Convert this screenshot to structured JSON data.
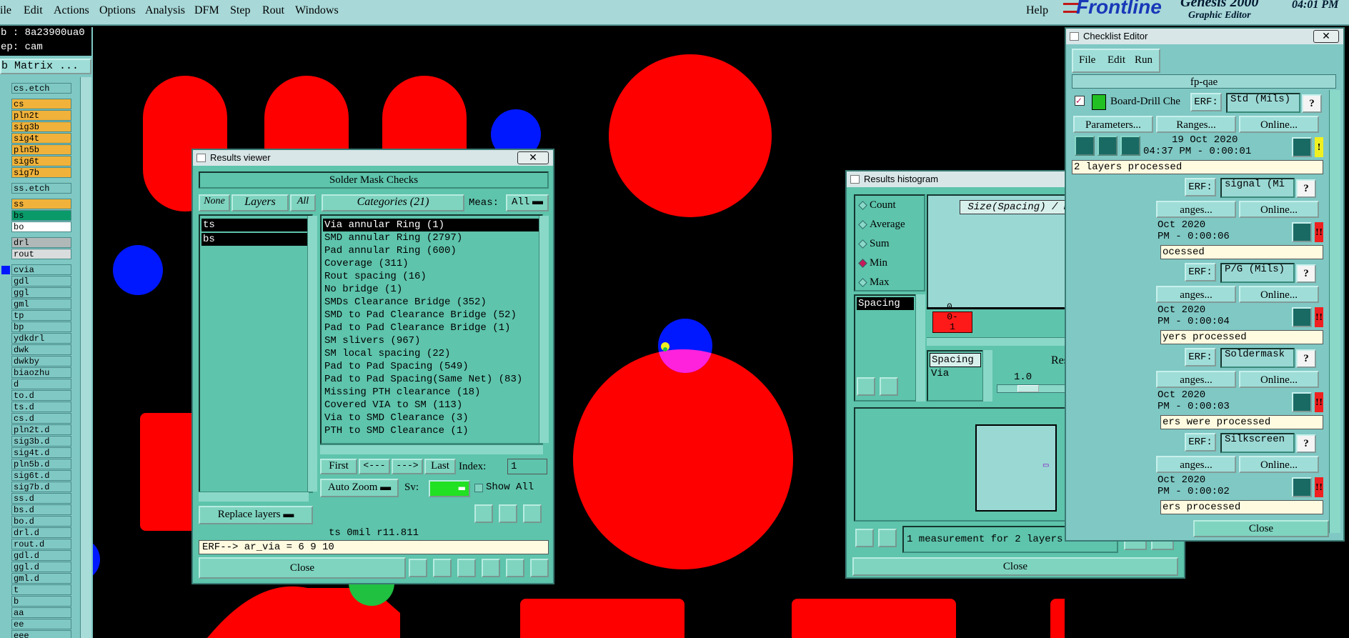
{
  "menubar": {
    "items": [
      "ile",
      "Edit",
      "Actions",
      "Options",
      "Analysis",
      "DFM",
      "Step",
      "Rout",
      "Windows"
    ],
    "help": "Help",
    "brand": "Frontline",
    "product": "Genesis 2000",
    "subtitle": "Graphic Editor",
    "time": "04:01 PM"
  },
  "leftpanel": {
    "job": "b : 8a23900ua0",
    "step": "ep: cam",
    "matrix_button": "b Matrix ...",
    "layers": [
      {
        "name": "cs.etch",
        "color": "#7fc8c4"
      },
      {
        "name": "cs",
        "color": "#f0b23a"
      },
      {
        "name": "pln2t",
        "color": "#f0b23a"
      },
      {
        "name": "sig3b",
        "color": "#f0b23a"
      },
      {
        "name": "sig4t",
        "color": "#f0b23a"
      },
      {
        "name": "pln5b",
        "color": "#f0b23a"
      },
      {
        "name": "sig6t",
        "color": "#f0b23a"
      },
      {
        "name": "sig7b",
        "color": "#f0b23a"
      },
      {
        "name": "ss.etch",
        "color": "#7fc8c4"
      },
      {
        "name": "ss",
        "color": "#f0b23a"
      },
      {
        "name": "bs",
        "color": "#0a9a6a"
      },
      {
        "name": "bo",
        "color": "#ffffff"
      },
      {
        "name": "drl",
        "color": "#b0b8b8"
      },
      {
        "name": "rout",
        "color": "#d8dcdc"
      },
      {
        "name": "cvia",
        "color": "#7fc8c4"
      },
      {
        "name": "gdl",
        "color": "#7fc8c4"
      },
      {
        "name": "ggl",
        "color": "#7fc8c4"
      },
      {
        "name": "gml",
        "color": "#7fc8c4"
      },
      {
        "name": "tp",
        "color": "#7fc8c4"
      },
      {
        "name": "bp",
        "color": "#7fc8c4"
      },
      {
        "name": "ydkdrl",
        "color": "#7fc8c4"
      },
      {
        "name": "dwk",
        "color": "#7fc8c4"
      },
      {
        "name": "dwkby",
        "color": "#7fc8c4"
      },
      {
        "name": "biaozhu",
        "color": "#7fc8c4"
      },
      {
        "name": "d",
        "color": "#7fc8c4"
      },
      {
        "name": "to.d",
        "color": "#7fc8c4"
      },
      {
        "name": "ts.d",
        "color": "#7fc8c4"
      },
      {
        "name": "cs.d",
        "color": "#7fc8c4"
      },
      {
        "name": "pln2t.d",
        "color": "#7fc8c4"
      },
      {
        "name": "sig3b.d",
        "color": "#7fc8c4"
      },
      {
        "name": "sig4t.d",
        "color": "#7fc8c4"
      },
      {
        "name": "pln5b.d",
        "color": "#7fc8c4"
      },
      {
        "name": "sig6t.d",
        "color": "#7fc8c4"
      },
      {
        "name": "sig7b.d",
        "color": "#7fc8c4"
      },
      {
        "name": "ss.d",
        "color": "#7fc8c4"
      },
      {
        "name": "bs.d",
        "color": "#7fc8c4"
      },
      {
        "name": "bo.d",
        "color": "#7fc8c4"
      },
      {
        "name": "drl.d",
        "color": "#7fc8c4"
      },
      {
        "name": "rout.d",
        "color": "#7fc8c4"
      },
      {
        "name": "gdl.d",
        "color": "#7fc8c4"
      },
      {
        "name": "ggl.d",
        "color": "#7fc8c4"
      },
      {
        "name": "gml.d",
        "color": "#7fc8c4"
      },
      {
        "name": "t",
        "color": "#7fc8c4"
      },
      {
        "name": "b",
        "color": "#7fc8c4"
      },
      {
        "name": "aa",
        "color": "#7fc8c4"
      },
      {
        "name": "ee",
        "color": "#7fc8c4"
      },
      {
        "name": "eee",
        "color": "#7fc8c4"
      }
    ]
  },
  "results_viewer": {
    "title": "Results viewer",
    "header": "Solder Mask Checks",
    "none_label": "None",
    "layers_label": "Layers",
    "all_label": "All",
    "categories_label": "Categories (21)",
    "meas_label": "Meas:",
    "meas_value": "All",
    "layers": [
      "ts",
      "bs"
    ],
    "categories": [
      "Via annular Ring (1)",
      "SMD annular Ring (2797)",
      "Pad annular Ring (600)",
      "Coverage (311)",
      "Rout spacing (16)",
      "No bridge (1)",
      "SMDs Clearance Bridge (352)",
      "SMD to Pad Clearance Bridge (52)",
      "Pad to Pad Clearance Bridge (1)",
      "SM slivers (967)",
      "SM local spacing (22)",
      "Pad to Pad Spacing (549)",
      "Pad to Pad Spacing(Same Net) (83)",
      "Missing PTH clearance (18)",
      "Covered VIA to SM (113)",
      "Via to SMD Clearance (3)",
      "PTH to SMD Clearance (1)"
    ],
    "first_label": "First",
    "prev_label": "<---",
    "next_label": "--->",
    "last_label": "Last",
    "index_label": "Index:",
    "index_value": "1",
    "autozoom_label": "Auto Zoom",
    "sv_label": "Sv:",
    "showall_label": "Show All",
    "replace_label": "Replace layers",
    "status": "ts 0mil  r11.811",
    "erf": "ERF--> ar_via = 6 9 10",
    "close_label": "Close"
  },
  "histogram": {
    "title": "Results histogram",
    "modes": [
      {
        "label": "Count",
        "selected": false
      },
      {
        "label": "Average",
        "selected": false
      },
      {
        "label": "Sum",
        "selected": false
      },
      {
        "label": "Min",
        "selected": true
      },
      {
        "label": "Max",
        "selected": false
      }
    ],
    "chart_title": "Size(Spacing) / Min(Spacing)",
    "count_label": "0",
    "bin_label": "0-\n1",
    "list": [
      "Spacing"
    ],
    "resolution_items": [
      "Spacing",
      "Via"
    ],
    "resolution_label": "Resolution",
    "resolution_value": "1.0",
    "status": "1 measurement for 2 layers",
    "close_label": "Close"
  },
  "checklist": {
    "title": "Checklist Editor",
    "menu": [
      "File",
      "Edit",
      "Run"
    ],
    "name": "fp-qae",
    "checks": [
      {
        "name": "Board-Drill Che",
        "erf": "Std (Mils)",
        "date": "19 Oct 2020",
        "time": "04:37 PM - 0:00:01",
        "status": "2 layers processed",
        "flag": "!",
        "flag_color": "#f0f020"
      },
      {
        "name": "",
        "erf": "signal (Mi",
        "date": "Oct 2020",
        "time": "PM - 0:00:06",
        "status": "ocessed",
        "flag": "!!",
        "flag_color": "#f02020"
      },
      {
        "name": "",
        "erf": "P/G (Mils)",
        "date": "Oct 2020",
        "time": "PM - 0:00:04",
        "status": "yers processed",
        "flag": "!!",
        "flag_color": "#f02020"
      },
      {
        "name": "",
        "erf": "Soldermask",
        "date": "Oct 2020",
        "time": "PM - 0:00:03",
        "status": "ers were processed",
        "flag": "!!",
        "flag_color": "#f02020"
      },
      {
        "name": "",
        "erf": "Silkscreen",
        "date": "Oct 2020",
        "time": "PM - 0:00:02",
        "status": "ers processed",
        "flag": "!!",
        "flag_color": "#f02020"
      }
    ],
    "erf_label": "ERF:",
    "params_label": "Parameters...",
    "ranges_label": "Ranges...",
    "anges_label": "anges...",
    "online_label": "Online...",
    "close_label": "Close"
  },
  "colors": {
    "pad_red": "#ff0000",
    "via_blue": "#0018ff",
    "overlap_magenta": "#ff22dd",
    "window_bg": "#5ec4ac",
    "menubar_bg": "#a8d8d8"
  }
}
